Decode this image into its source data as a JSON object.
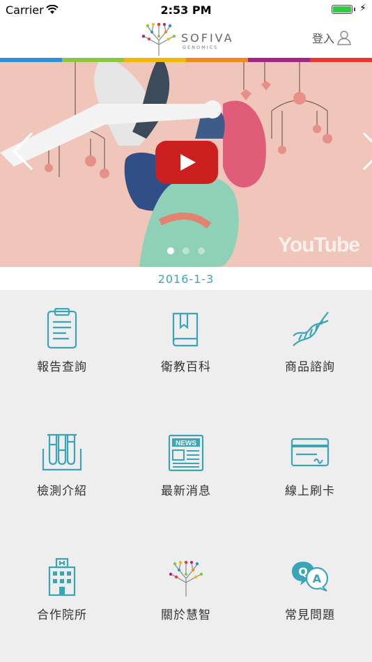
{
  "status_bar": {
    "carrier": "Carrier",
    "time": "2:53 PM"
  },
  "header": {
    "brand": "SOFIVA",
    "brand_sub": "GENOMICS",
    "login_label": "登入"
  },
  "color_strip": [
    "#2f8fd8",
    "#8cc63f",
    "#f5b800",
    "#f08a1c",
    "#a8237f",
    "#e8382d"
  ],
  "carousel": {
    "watermark": "YouTube",
    "date": "2016-1-3",
    "page_count": 3,
    "active_page": 1
  },
  "menu": [
    {
      "label": "報告查詢",
      "icon": "clipboard-report-icon"
    },
    {
      "label": "衛教百科",
      "icon": "book-icon"
    },
    {
      "label": "商品諮詢",
      "icon": "dna-icon"
    },
    {
      "label": "檢測介紹",
      "icon": "test-tubes-icon"
    },
    {
      "label": "最新消息",
      "icon": "newspaper-icon"
    },
    {
      "label": "線上刷卡",
      "icon": "credit-card-icon"
    },
    {
      "label": "合作院所",
      "icon": "hospital-icon"
    },
    {
      "label": "關於慧智",
      "icon": "tree-logo-icon"
    },
    {
      "label": "常見問題",
      "icon": "qa-bubble-icon"
    }
  ],
  "colors": {
    "accent": "#3aa5b8",
    "play": "#cc1f1f"
  }
}
